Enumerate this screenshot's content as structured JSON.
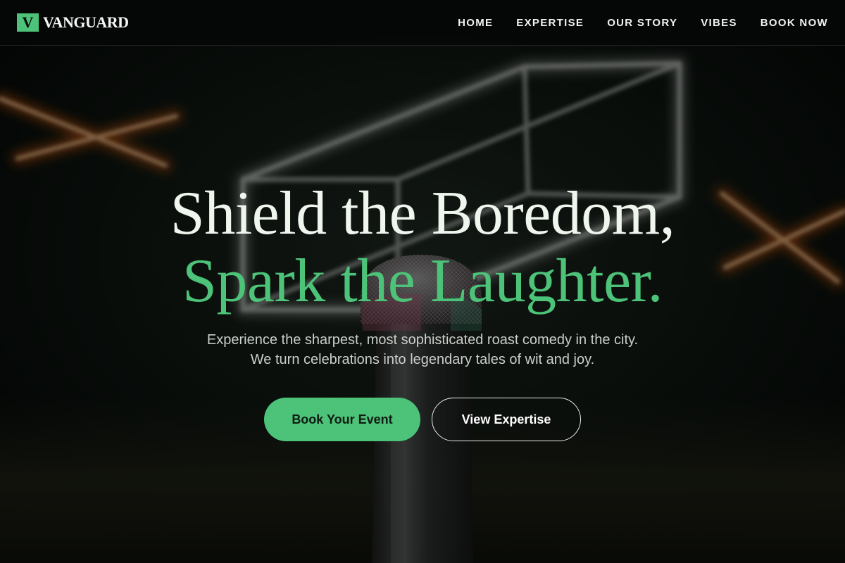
{
  "brand": {
    "mark": "V",
    "name": "VANGUARD"
  },
  "nav": {
    "items": [
      {
        "label": "HOME"
      },
      {
        "label": "EXPERTISE"
      },
      {
        "label": "OUR STORY"
      },
      {
        "label": "VIBES"
      },
      {
        "label": "BOOK NOW"
      }
    ]
  },
  "hero": {
    "headline_line1": "Shield the Boredom,",
    "headline_line2": "Spark the Laughter.",
    "subtitle_line1": "Experience the sharpest, most sophisticated roast comedy in the city.",
    "subtitle_line2": "We turn celebrations into legendary tales of wit and joy.",
    "primary_cta": "Book Your Event",
    "secondary_cta": "View Expertise"
  },
  "colors": {
    "accent": "#4cc378",
    "background": "#050806",
    "neon_orange": "#ff7a1a"
  },
  "background_image": {
    "icon": "microphone-icon"
  }
}
